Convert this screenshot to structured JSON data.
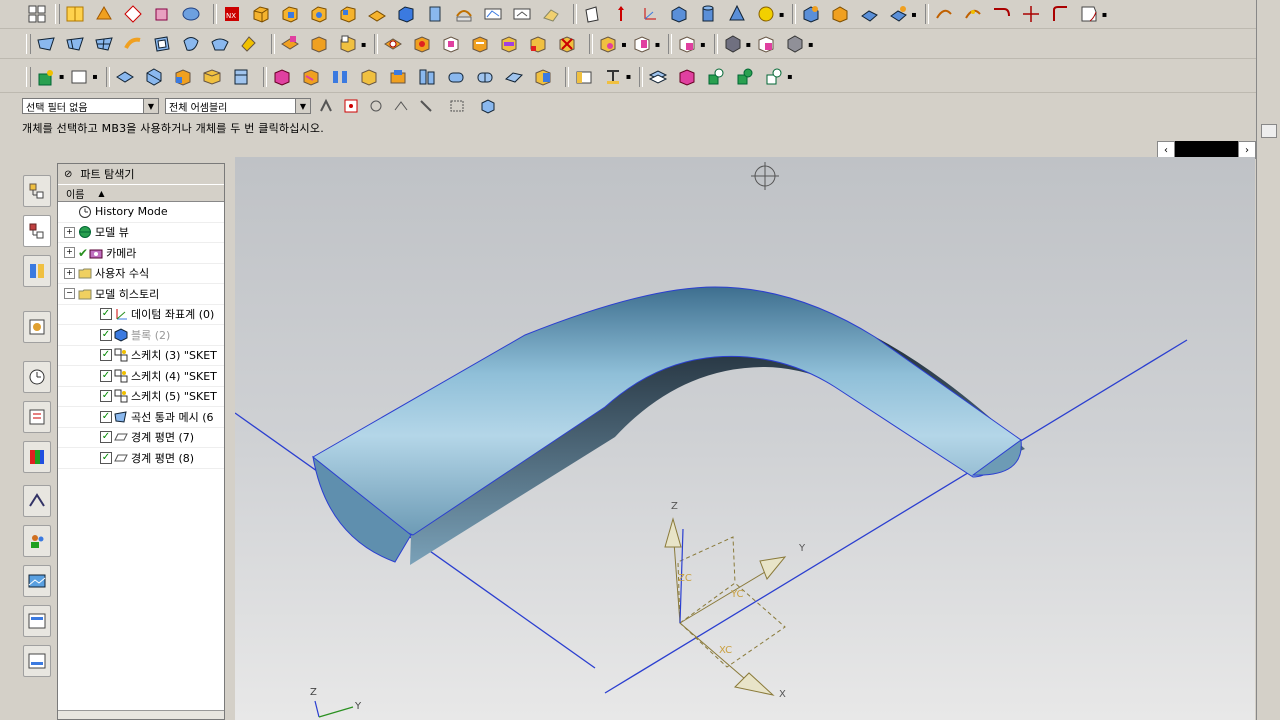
{
  "filter_bar": {
    "selection_filter": "선택 필터 없음",
    "selection_scope": "전체 어셈블리"
  },
  "status": {
    "message": "개체를 선택하고 MB3을 사용하거나 개체를 두 번 클릭하십시오."
  },
  "navigator": {
    "title": "파트 탐색기",
    "column_header": "이름",
    "items": [
      {
        "label": "History Mode",
        "type": "history"
      },
      {
        "label": "모델 뷰",
        "type": "group"
      },
      {
        "label": "카메라",
        "type": "group"
      },
      {
        "label": "사용자 수식",
        "type": "group"
      },
      {
        "label": "모델 히스토리",
        "type": "group"
      },
      {
        "label": "데이텀 좌표계 (0)",
        "type": "feature"
      },
      {
        "label": "블록 (2)",
        "type": "feature"
      },
      {
        "label": "스케치 (3) \"SKET",
        "type": "feature"
      },
      {
        "label": "스케치 (4) \"SKET",
        "type": "feature"
      },
      {
        "label": "스케치 (5) \"SKET",
        "type": "feature"
      },
      {
        "label": "곡선 통과 메시 (6",
        "type": "feature"
      },
      {
        "label": "경계 평면 (7)",
        "type": "feature"
      },
      {
        "label": "경계 평면 (8)",
        "type": "feature"
      }
    ]
  },
  "viewport": {
    "csys_labels": {
      "z": "Z",
      "y": "Y",
      "x": "X",
      "zc": "ZC",
      "yc": "YC",
      "xc": "XC"
    },
    "triad_labels": {
      "z": "Z",
      "y": "Y"
    }
  }
}
